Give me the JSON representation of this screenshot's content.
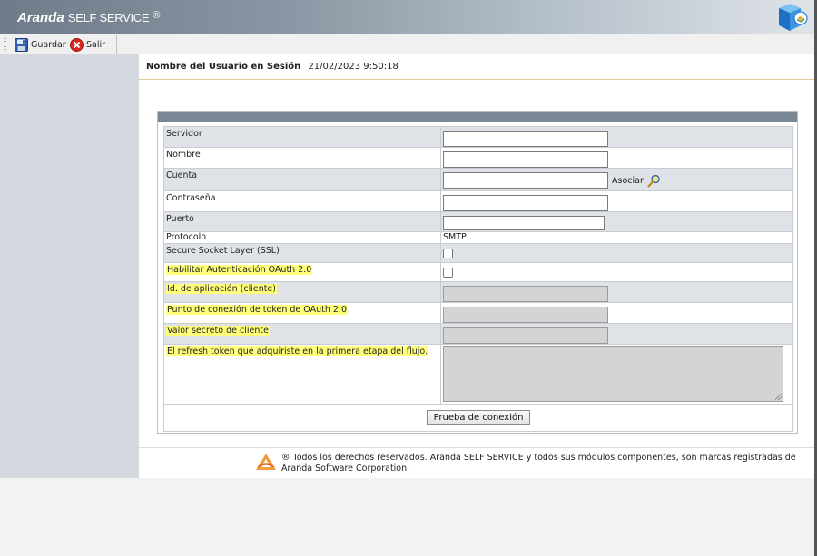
{
  "app": {
    "brand_bold": "Aranda",
    "brand_rest": "SELF SERVICE",
    "brand_mark": "®"
  },
  "toolbar": {
    "save_label": "Guardar",
    "exit_label": "Salir"
  },
  "session": {
    "label": "Nombre del Usuario en Sesión",
    "datetime": "21/02/2023 9:50:18"
  },
  "form": {
    "rows": {
      "servidor": "Servidor",
      "nombre": "Nombre",
      "cuenta": "Cuenta",
      "asociar": "Asociar",
      "contrasena": "Contraseña",
      "puerto": "Puerto",
      "protocolo": "Protocolo",
      "protocolo_value": "SMTP",
      "ssl": "Secure Socket Layer (SSL)",
      "oauth": "Habilitar Autenticación OAuth 2.0",
      "app_id": "Id. de aplicación (cliente)",
      "token_endpoint": "Punto de conexión de token de OAuth 2.0",
      "client_secret": "Valor secreto de cliente",
      "refresh_token": "El refresh token que adquiriste en la primera etapa del flujo."
    },
    "test_button": "Prueba de conexión"
  },
  "footer": {
    "text": "® Todos los derechos reservados. Aranda SELF SERVICE y todos sus módulos componentes, son marcas registradas de Aranda Software Corporation."
  },
  "colors": {
    "highlight": "#ffff7a",
    "sidebar": "#d3d9df",
    "header_band": "#7a8794"
  }
}
